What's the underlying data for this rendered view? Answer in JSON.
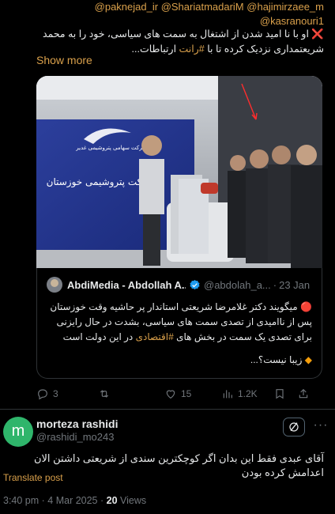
{
  "tweet": {
    "mentions_line1": [
      "@paknejad_ir",
      "@ShariatmadariM",
      "@hajimirzaee_m"
    ],
    "mentions_line2": [
      "@kasranouri1"
    ],
    "cross_emoji": "❌",
    "text_part1": "او با نا امید شدن از اشتغال به سمت های سیاسی، خود را به محمد شریعتمداری نزدیک کرده تا با ",
    "hashtag": "#رانت",
    "text_part2": " ارتباطات...",
    "show_more": "Show more",
    "media_sign_line1": "شرکت سهامی پتروشیمی غدیر",
    "media_sign_line2": "شرکت پتروشیمی خوزستان"
  },
  "quote": {
    "author_name": "AbdiMedia - Abdollah A...",
    "handle": "@abdolah_a...",
    "separator": "·",
    "date": "23 Jan",
    "bullet": "🔴",
    "body_part1": " میگویند دکتر غلامرضا شریعتی استاندار پر حاشیه وقت خوزستان پس از ناامیدی از تصدی سمت های سیاسی، بشدت در حال رایزنی برای تصدی یک سمت در بخش های ",
    "body_hashtag": "#اقتصادی",
    "body_part2": " در این دولت است",
    "line2_icon": "◆",
    "line2_text": " زیبا نیست؟..."
  },
  "actions": {
    "replies": "3",
    "retweets": "",
    "likes": "15",
    "views": "1.2K"
  },
  "reply": {
    "avatar_letter": "m",
    "name": "morteza rashidi",
    "handle": "@rashidi_mo243",
    "text": "آقای عبدی فقط این بدان اگر کوچکترین سندی از شریعتی داشتن الان اعدامش کرده بودن",
    "translate": "Translate post",
    "time": "3:40 pm",
    "date_sep": " · ",
    "date": "4 Mar 2025",
    "views_count": "20",
    "views_label": " Views",
    "more_label": "···"
  },
  "colors": {
    "accent": "#d9a04b",
    "background": "#000000",
    "muted": "#71767b",
    "verified": "#1d9bf0",
    "avatar": "#2fb56b"
  }
}
